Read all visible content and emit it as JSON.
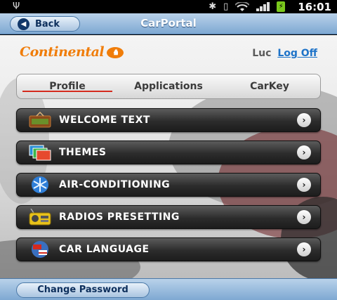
{
  "status_bar": {
    "time": "16:01",
    "icons": [
      "usb-icon",
      "bluetooth-icon",
      "vibrate-icon",
      "wifi-icon",
      "signal-icon",
      "battery-charging-icon"
    ],
    "battery_glyph": "⚡"
  },
  "header": {
    "back_label": "Back",
    "title": "CarPortal"
  },
  "branding": {
    "logo_text": "Continental",
    "logo_color": "#f07d0a"
  },
  "user": {
    "name": "Luc",
    "logoff_label": "Log Off"
  },
  "tabs": [
    {
      "label": "Profile",
      "active": true
    },
    {
      "label": "Applications",
      "active": false
    },
    {
      "label": "CarKey",
      "active": false
    }
  ],
  "menu": [
    {
      "label": "WELCOME TEXT",
      "icon": "welcome-sign-icon"
    },
    {
      "label": "THEMES",
      "icon": "themes-icon"
    },
    {
      "label": "AIR-CONDITIONING",
      "icon": "snowflake-icon"
    },
    {
      "label": "RADIOS PRESETTING",
      "icon": "radio-icon"
    },
    {
      "label": "CAR LANGUAGE",
      "icon": "globe-flags-icon"
    }
  ],
  "footer": {
    "change_password_label": "Change Password"
  },
  "colors": {
    "accent_blue": "#7ea8d2",
    "active_tab_underline": "#d42a1e",
    "link": "#1e73c8"
  }
}
